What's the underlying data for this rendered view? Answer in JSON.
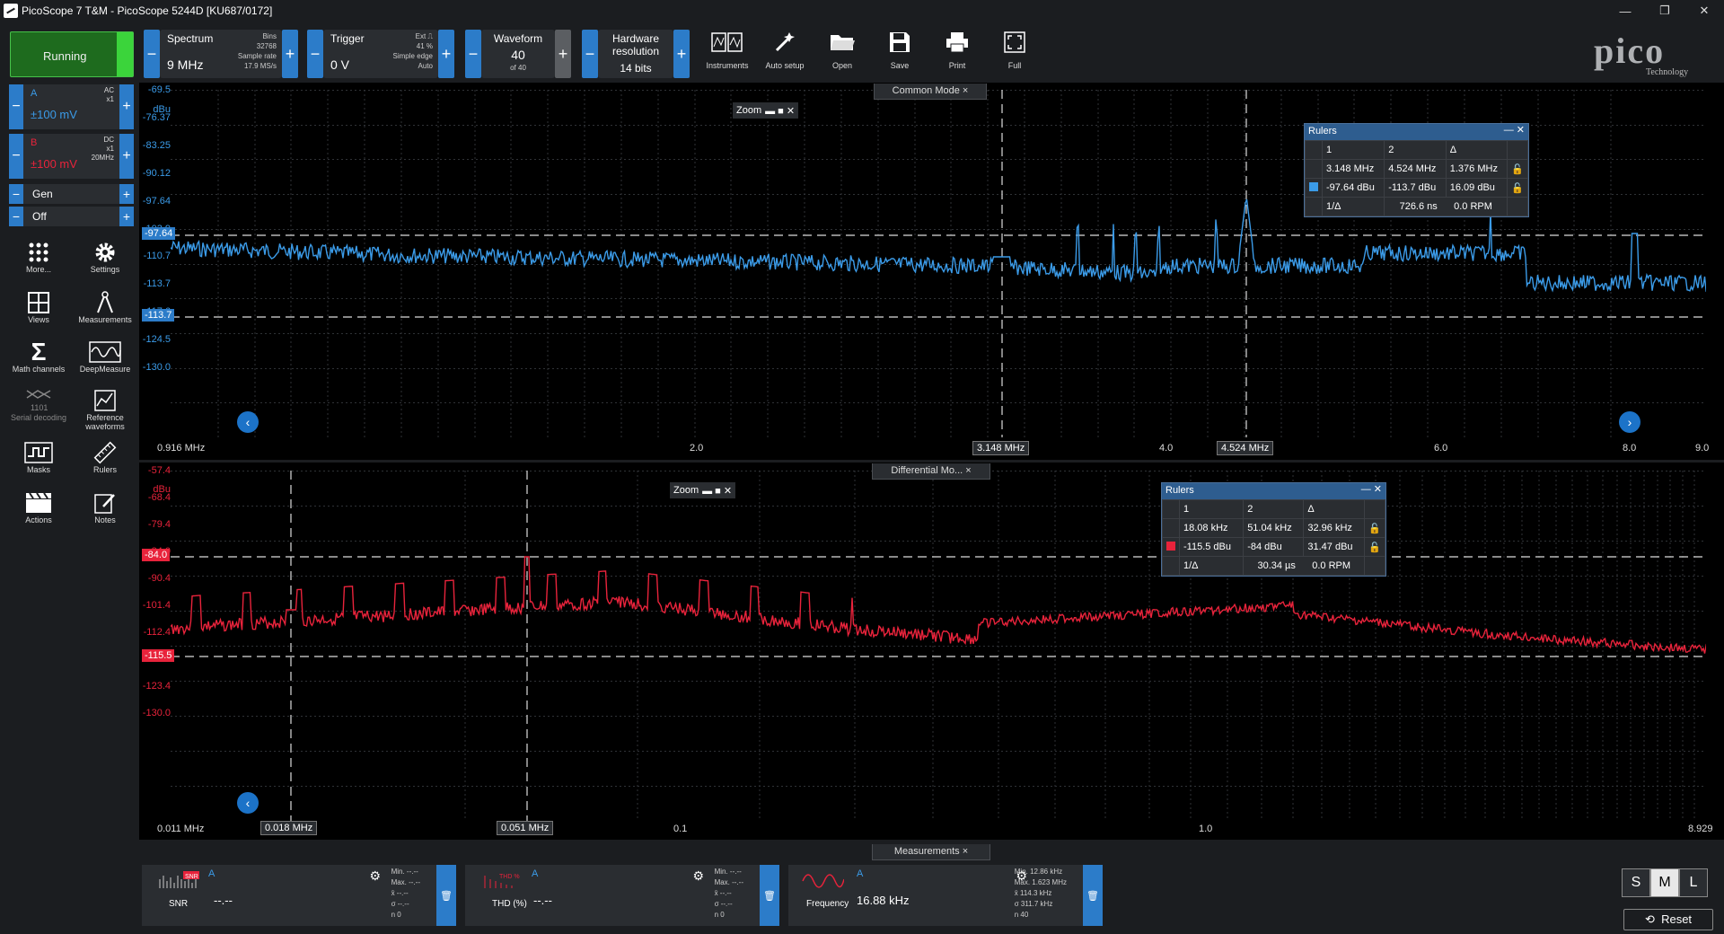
{
  "title": "PicoScope 7 T&M  - PicoScope 5244D [KU687/0172]",
  "window": {
    "min": "—",
    "max": "❐",
    "close": "✕"
  },
  "status": "Running",
  "spectrum": {
    "label": "Spectrum",
    "value": "9 MHz",
    "bins_label": "Bins",
    "bins": "32768",
    "rate_label": "Sample rate",
    "rate": "17.9 MS/s"
  },
  "trigger": {
    "label": "Trigger",
    "value": "0 V",
    "ext": "Ext",
    "pct": "41 %",
    "mode": "Simple edge",
    "auto": "Auto"
  },
  "waveform": {
    "label": "Waveform",
    "value": "40",
    "of": "of 40"
  },
  "hwres": {
    "label1": "Hardware",
    "label2": "resolution",
    "value": "14 bits"
  },
  "tools": [
    "Instruments",
    "Auto setup",
    "Open",
    "Save",
    "Print",
    "Full"
  ],
  "logo": {
    "word": "pico",
    "sub": "Technology"
  },
  "chA": {
    "name": "A",
    "range": "±100 mV",
    "cpl1": "AC",
    "cpl2": "x1"
  },
  "chB": {
    "name": "B",
    "range": "±100 mV",
    "cpl1": "DC",
    "cpl2": "x1",
    "cpl3": "20MHz"
  },
  "gen": "Gen",
  "off": "Off",
  "sidetools": [
    "More...",
    "Settings",
    "Views",
    "Measurements",
    "Math channels",
    "DeepMeasure",
    "Serial decoding",
    "Reference waveforms",
    "Masks",
    "Rulers",
    "Actions",
    "Notes"
  ],
  "pane1": {
    "tab": "Common Mode",
    "unit": "dBu",
    "yticks": [
      "-69.5",
      "-76.37",
      "-83.25",
      "-90.12",
      "-97.64",
      "-103.9",
      "-110.7",
      "-113.7",
      "-117.6",
      "-124.5",
      "-130.0"
    ],
    "xticks": [
      "0.916 MHz",
      "2.0",
      "4.0",
      "6.0",
      "8.0",
      "9.0"
    ],
    "ruler_y1": "-97.64",
    "ruler_y2": "-113.7",
    "ruler_x1": "3.148 MHz",
    "ruler_x2": "4.524 MHz",
    "zoom": "Zoom",
    "rulers": {
      "title": "Rulers",
      "h1": "1",
      "h2": "2",
      "h3": "Δ",
      "r1": [
        "3.148 MHz",
        "4.524 MHz",
        "1.376 MHz"
      ],
      "r2": [
        "-97.64 dBu",
        "-113.7 dBu",
        "16.09 dBu"
      ],
      "inv_label": "1/Δ",
      "inv": "726.6 ns",
      "rpm": "0.0 RPM"
    },
    "color": "#3b9be8"
  },
  "pane2": {
    "tab": "Differential Mo...",
    "unit": "dBu",
    "yticks": [
      "-57.4",
      "-68.4",
      "-79.4",
      "-84.0",
      "-90.4",
      "-101.4",
      "-112.4",
      "-115.5",
      "-123.4",
      "-130.0"
    ],
    "xticks": [
      "0.011 MHz",
      "0.1",
      "1.0",
      "8.929"
    ],
    "ruler_y1": "-84.0",
    "ruler_y2": "-115.5",
    "ruler_x1": "0.018 MHz",
    "ruler_x2": "0.051 MHz",
    "zoom": "Zoom",
    "rulers": {
      "title": "Rulers",
      "h1": "1",
      "h2": "2",
      "h3": "Δ",
      "r1": [
        "18.08 kHz",
        "51.04 kHz",
        "32.96 kHz"
      ],
      "r2": [
        "-115.5 dBu",
        "-84 dBu",
        "31.47 dBu"
      ],
      "inv_label": "1/Δ",
      "inv": "30.34 µs",
      "rpm": "0.0 RPM"
    },
    "color": "#e8233b"
  },
  "meas_tab": "Measurements",
  "meas": [
    {
      "icon_label": "SNR",
      "ch": "A",
      "name": "SNR",
      "value": "--.--",
      "stats": [
        "Min.  --.--",
        "Max.  --.--",
        "x̄     --.--",
        "σ     --.--",
        "n     0"
      ]
    },
    {
      "icon_label": "THD %",
      "ch": "A",
      "name": "THD (%)",
      "value": "--.--",
      "stats": [
        "Min.  --.--",
        "Max.  --.--",
        "x̄     --.--",
        "σ     --.--",
        "n     0"
      ]
    },
    {
      "icon_label": "",
      "ch": "A",
      "name": "Frequency",
      "value": "16.88 kHz",
      "stats": [
        "Min.  12.86 kHz",
        "Max.  1.623 MHz",
        "x̄     114.3 kHz",
        "σ     311.7 kHz",
        "n     40"
      ]
    }
  ],
  "size": [
    "S",
    "M",
    "L"
  ],
  "reset": "Reset"
}
